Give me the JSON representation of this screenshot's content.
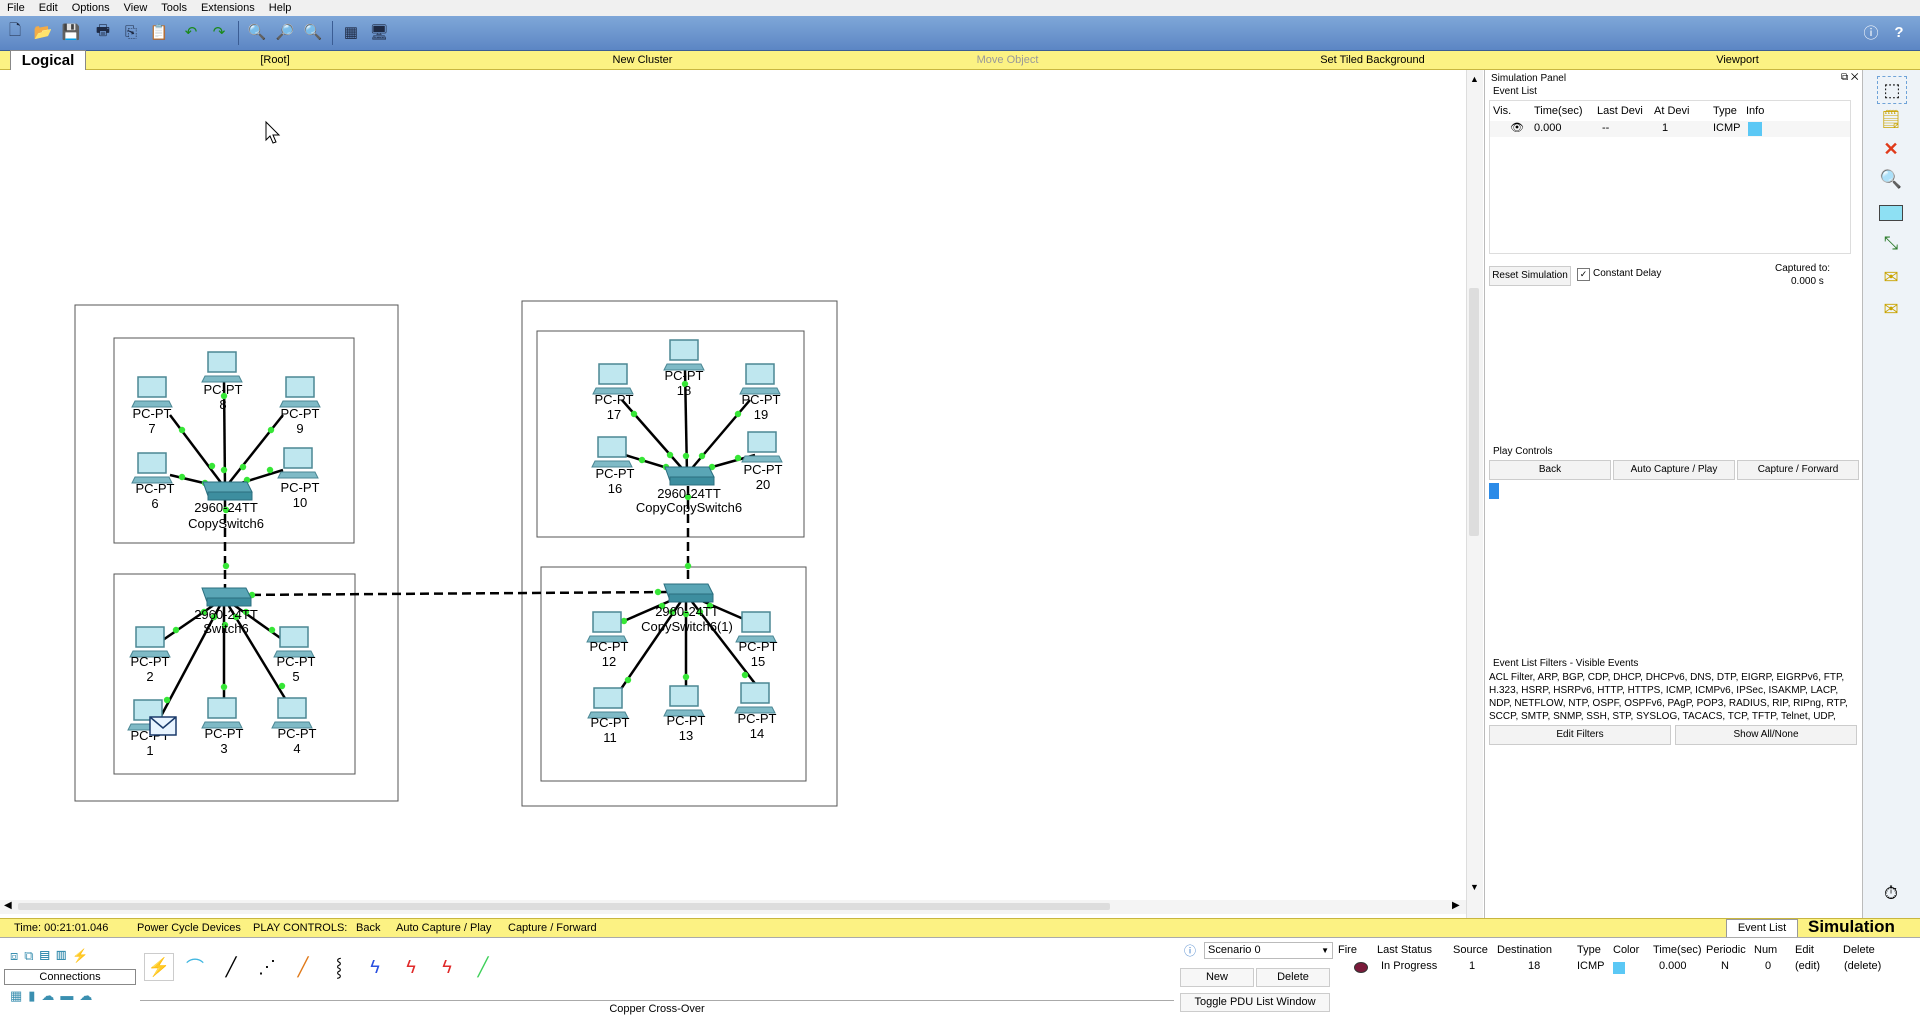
{
  "menu": [
    "File",
    "Edit",
    "Options",
    "View",
    "Tools",
    "Extensions",
    "Help"
  ],
  "logical_tab": "Logical",
  "yellowbar": [
    "[Root]",
    "New Cluster",
    "Move Object",
    "Set Tiled Background",
    "Viewport"
  ],
  "canvas": {
    "devices": [
      {
        "label": "PC-PT",
        "num": "7"
      },
      {
        "label": "PC-PT",
        "num": "8"
      },
      {
        "label": "PC-PT",
        "num": "9"
      },
      {
        "label": "PC-PT",
        "num": "6"
      },
      {
        "label": "PC-PT",
        "num": "10"
      },
      {
        "label": "PC-PT",
        "num": "2"
      },
      {
        "label": "PC-PT",
        "num": "5"
      },
      {
        "label": "PC-PT",
        "num": "1"
      },
      {
        "label": "PC-PT",
        "num": "3"
      },
      {
        "label": "PC-PT",
        "num": "4"
      },
      {
        "label": "PC-PT",
        "num": "17"
      },
      {
        "label": "PC-PT",
        "num": "18"
      },
      {
        "label": "PC-PT",
        "num": "19"
      },
      {
        "label": "PC-PT",
        "num": "16"
      },
      {
        "label": "PC-PT",
        "num": "20"
      },
      {
        "label": "PC-PT",
        "num": "12"
      },
      {
        "label": "PC-PT",
        "num": "15"
      },
      {
        "label": "PC-PT",
        "num": "11"
      },
      {
        "label": "PC-PT",
        "num": "13"
      },
      {
        "label": "PC-PT",
        "num": "14"
      }
    ],
    "switches": [
      {
        "model": "2960-24TT",
        "name": "CopySwitch6"
      },
      {
        "model": "2960-24TT",
        "name": "Switch6"
      },
      {
        "model": "2960-24TT",
        "name": "CopyCopySwitch6"
      },
      {
        "model": "2960-24TT",
        "name": "CopySwitch6(1)"
      }
    ]
  },
  "sim_panel": {
    "title": "Simulation Panel",
    "event_list_label": "Event List",
    "columns": [
      "Vis.",
      "Time(sec)",
      "Last Devi",
      "At Devi",
      "Type",
      "Info"
    ],
    "event": {
      "time": "0.000",
      "last": "--",
      "at": "1",
      "type": "ICMP",
      "info_color": "#5bc8f5"
    },
    "reset_btn": "Reset Simulation",
    "constant_delay": "Constant Delay",
    "captured_to_label": "Captured to:",
    "captured_to_value": "0.000 s",
    "play_controls": "Play Controls",
    "back": "Back",
    "auto_capture": "Auto Capture / Play",
    "capture_forward": "Capture / Forward",
    "filters_title": "Event List Filters - Visible Events",
    "filters_text": "ACL Filter, ARP, BGP, CDP, DHCP, DHCPv6, DNS, DTP, EIGRP, EIGRPv6, FTP, H.323, HSRP, HSRPv6, HTTP, HTTPS, ICMP, ICMPv6, IPSec, ISAKMP, LACP, NDP, NETFLOW, NTP, OSPF, OSPFv6, PAgP, POP3, RADIUS, RIP, RIPng, RTP, SCCP, SMTP, SNMP, SSH, STP, SYSLOG, TACACS, TCP, TFTP, Telnet, UDP, VTP",
    "edit_filters": "Edit Filters",
    "show_all": "Show All/None"
  },
  "statusbar": {
    "time": "Time: 00:21:01.046",
    "power_cycle": "Power Cycle Devices",
    "play_controls": "PLAY CONTROLS:",
    "back": "Back",
    "auto_capture": "Auto Capture / Play",
    "capture_forward": "Capture / Forward",
    "event_list": "Event List",
    "simulation": "Simulation"
  },
  "bottom": {
    "connections": "Connections",
    "cable_caption": "Copper Cross-Over",
    "scenario": "Scenario 0",
    "new": "New",
    "delete": "Delete",
    "toggle_pdu": "Toggle PDU List Window",
    "pdu_headers": [
      "Fire",
      "Last Status",
      "Source",
      "Destination",
      "Type",
      "Color",
      "Time(sec)",
      "Periodic",
      "Num",
      "Edit",
      "Delete"
    ],
    "pdu_row": {
      "status": "In Progress",
      "source": "1",
      "destination": "18",
      "type": "ICMP",
      "color": "#5bc8f5",
      "time": "0.000",
      "periodic": "N",
      "num": "0",
      "edit": "(edit)",
      "delete": "(delete)"
    }
  }
}
